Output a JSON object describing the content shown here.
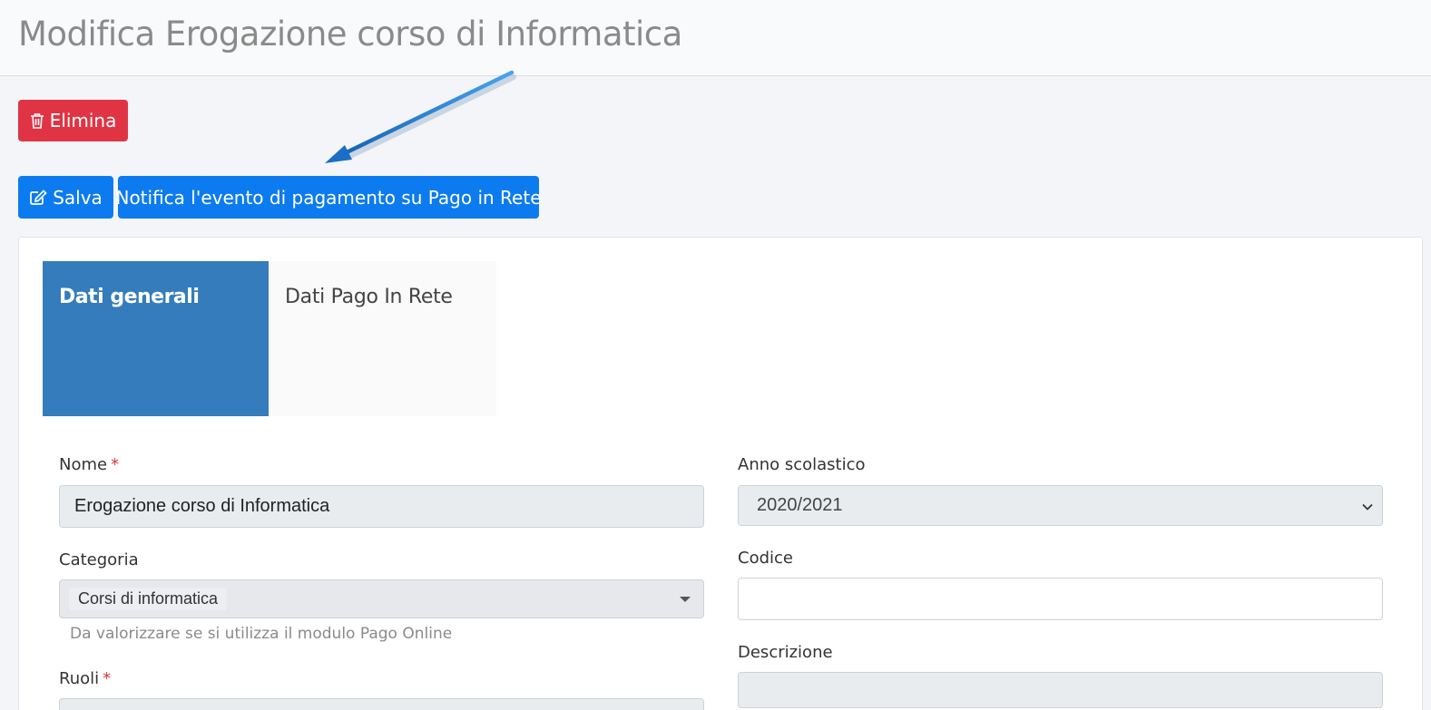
{
  "header": {
    "title": "Modifica Erogazione corso di Informatica"
  },
  "actions": {
    "delete_label": "Elimina",
    "save_label": "Salva",
    "notify_label": "Notifica l'evento di pagamento su Pago in Rete"
  },
  "tabs": [
    {
      "label": "Dati generali",
      "active": true
    },
    {
      "label": "Dati Pago In Rete",
      "active": false
    }
  ],
  "form": {
    "nome": {
      "label": "Nome",
      "value": "Erogazione corso di Informatica",
      "required": "*"
    },
    "anno": {
      "label": "Anno scolastico",
      "value": "2020/2021"
    },
    "categoria": {
      "label": "Categoria",
      "value": "Corsi di informatica",
      "help": "Da valorizzare se si utilizza il modulo Pago Online"
    },
    "codice": {
      "label": "Codice",
      "value": ""
    },
    "ruoli": {
      "label": "Ruoli",
      "required": "*"
    },
    "descrizione": {
      "label": "Descrizione"
    }
  },
  "colors": {
    "danger": "#e03444",
    "primary": "#0d7bf0",
    "tab_active": "#347cbc",
    "arrow": "#1f77c9"
  },
  "icons": {
    "delete": "trash-icon",
    "save": "edit-icon",
    "annotation": "arrow-annotation"
  }
}
